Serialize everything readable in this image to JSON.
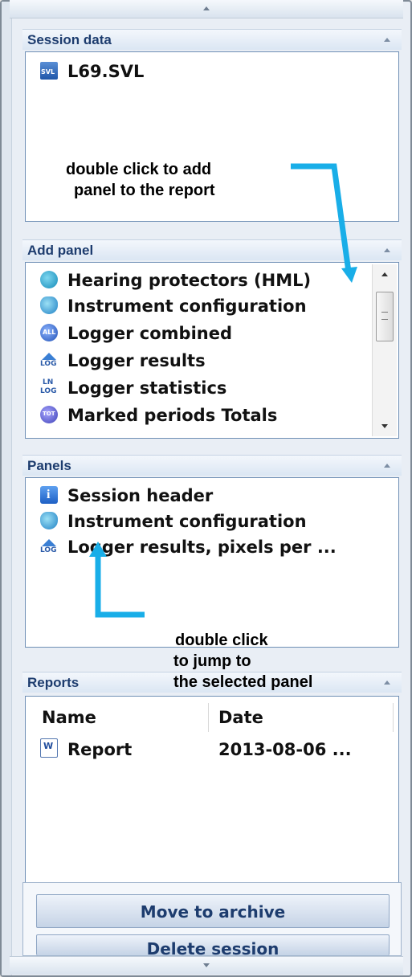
{
  "session_data": {
    "title": "Session data",
    "items": [
      {
        "label": "L69.SVL",
        "icon": "svl-file-icon"
      }
    ]
  },
  "add_panel": {
    "title": "Add panel",
    "items": [
      {
        "label": "Hearing protectors (HML)",
        "icon": "hearing-protector-icon"
      },
      {
        "label": "Instrument configuration",
        "icon": "instrument-config-icon"
      },
      {
        "label": "Logger combined",
        "icon": "logger-combined-icon"
      },
      {
        "label": "Logger results",
        "icon": "logger-results-icon"
      },
      {
        "label": "Logger statistics",
        "icon": "logger-statistics-icon"
      },
      {
        "label": "Marked periods Totals",
        "icon": "marked-periods-icon"
      }
    ]
  },
  "panels": {
    "title": "Panels",
    "items": [
      {
        "label": "Session header",
        "icon": "info-icon"
      },
      {
        "label": "Instrument configuration",
        "icon": "instrument-config-icon"
      },
      {
        "label": "Logger results, pixels per ...",
        "icon": "logger-results-icon"
      }
    ]
  },
  "reports": {
    "title": "Reports",
    "columns": [
      "Name",
      "Date"
    ],
    "rows": [
      {
        "name": "Report",
        "date": "2013-08-06 ...",
        "icon": "word-document-icon"
      }
    ]
  },
  "buttons": {
    "move_to_archive": "Move to archive",
    "delete_session": "Delete session"
  },
  "annotations": {
    "add_line1": "double click to add",
    "add_line2": "panel to the report",
    "jump_line1": "double click",
    "jump_line2": "to jump to",
    "jump_line3": "the selected panel"
  },
  "colors": {
    "arrow": "#19aee8",
    "header_text": "#1d3c6e",
    "panel_border": "#6f8fb5"
  }
}
